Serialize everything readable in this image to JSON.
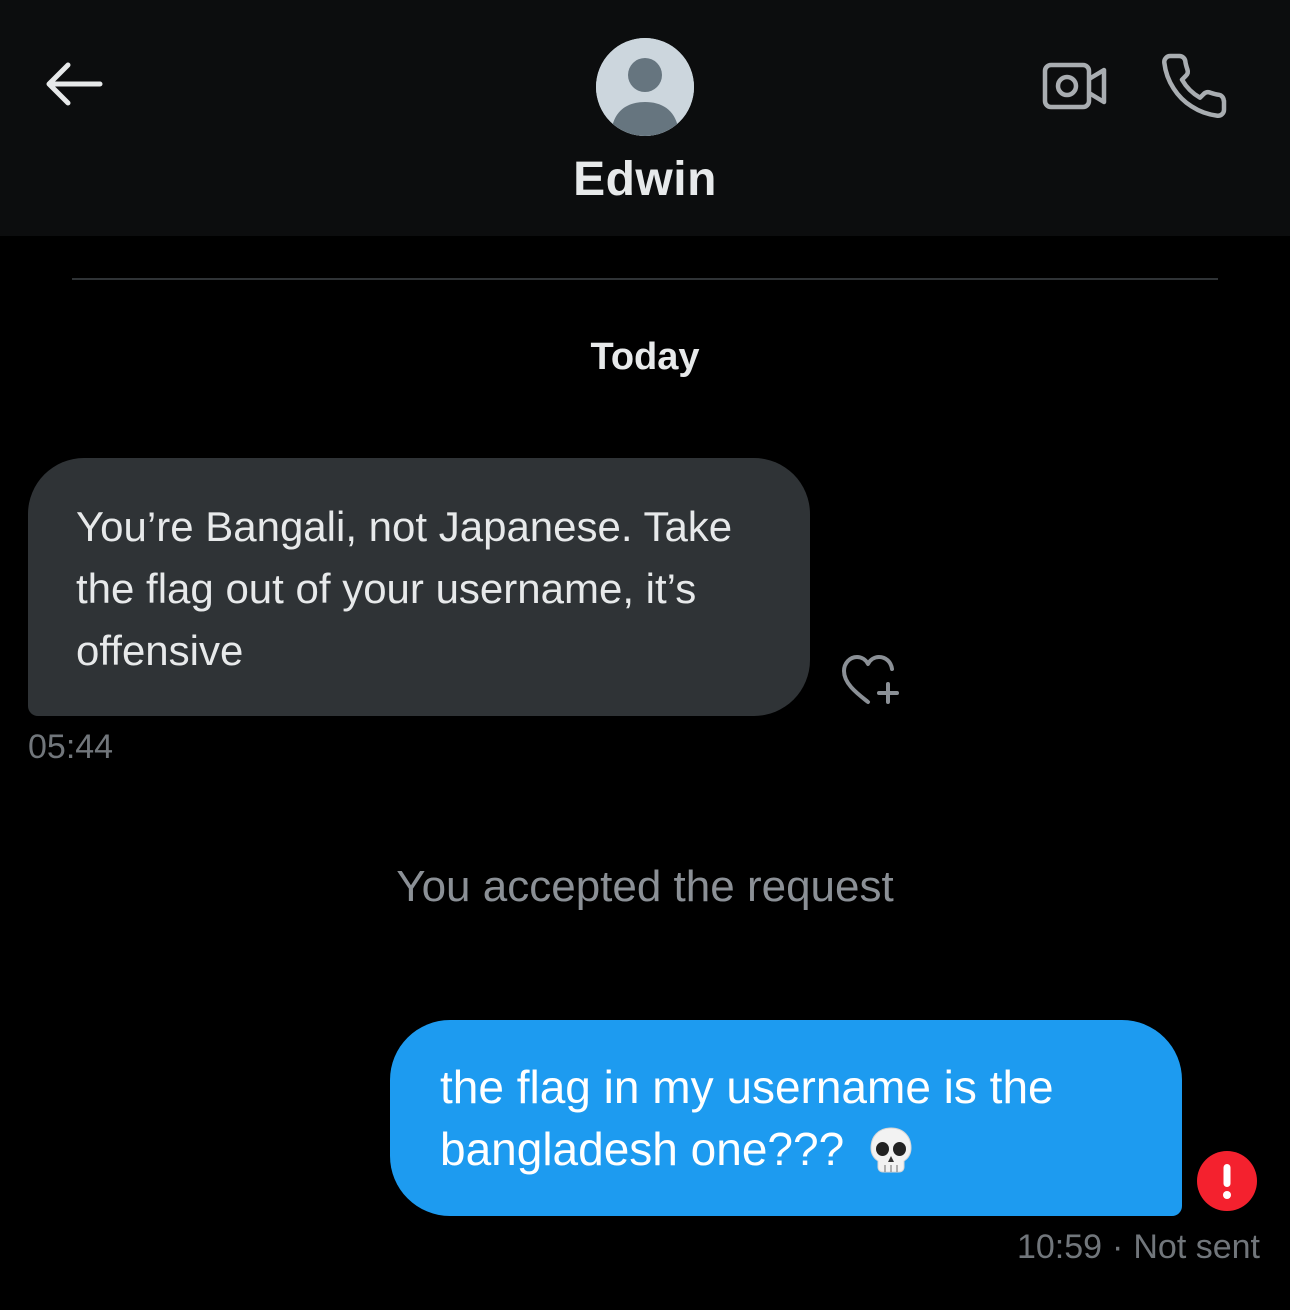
{
  "header": {
    "contact_name": "Edwin",
    "icons": {
      "back": "arrow-left-icon",
      "avatar": "default-avatar",
      "video": "video-camera-icon",
      "call": "phone-icon"
    }
  },
  "thread": {
    "date_separator": "Today",
    "messages": [
      {
        "direction": "incoming",
        "text": "You’re Bangali, not Japanese. Take the flag out of your username, it’s offensive",
        "time": "05:44",
        "reaction_icon": "heart-plus-icon"
      },
      {
        "direction": "system",
        "text": "You accepted the request"
      },
      {
        "direction": "outgoing",
        "text": "the flag in my username is the bangladesh one???",
        "emoji": "💀",
        "time": "10:59",
        "separator": "·",
        "status": "Not sent",
        "status_icon": "error-exclamation-icon"
      }
    ]
  },
  "colors": {
    "background": "#000000",
    "header_background": "#0c0d0e",
    "incoming_bubble": "#2f3336",
    "outgoing_bubble": "#1d9bf0",
    "error": "#f4212e",
    "muted_text": "#71767b"
  }
}
